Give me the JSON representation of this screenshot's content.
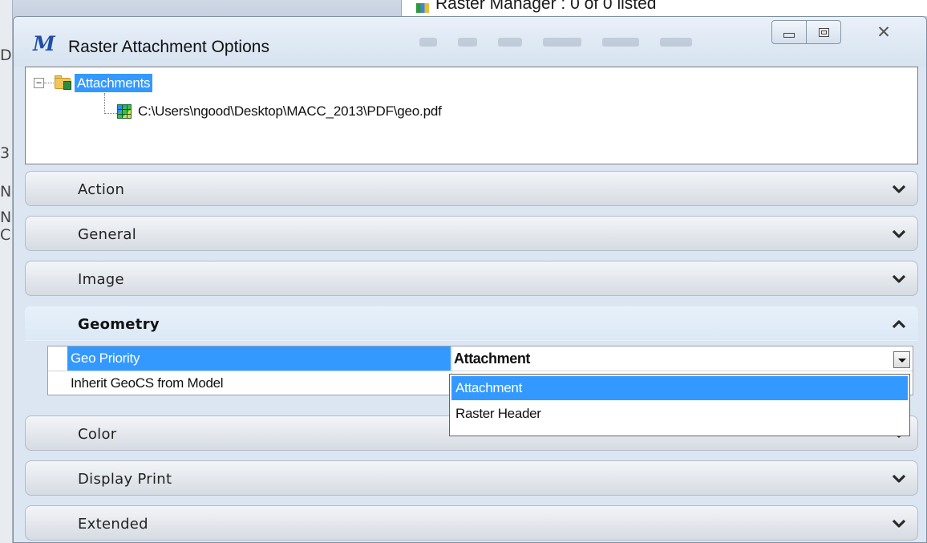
{
  "background": {
    "window_title": "Raster Manager : 0 of 0 listed",
    "left_edge_letters": [
      "D",
      "3",
      "N",
      "N",
      "C"
    ]
  },
  "dialog": {
    "title": "Raster Attachment Options",
    "tree": {
      "root_label": "Attachments",
      "root_expanded": true,
      "children": [
        {
          "label": "C:\\Users\\ngood\\Desktop\\MACC_2013\\PDF\\geo.pdf"
        }
      ]
    },
    "sections": [
      {
        "label": "Action",
        "expanded": false
      },
      {
        "label": "General",
        "expanded": false
      },
      {
        "label": "Image",
        "expanded": false
      },
      {
        "label": "Geometry",
        "expanded": true
      },
      {
        "label": "Color",
        "expanded": false
      },
      {
        "label": "Display Print",
        "expanded": false
      },
      {
        "label": "Extended",
        "expanded": false
      }
    ],
    "geometry_properties": [
      {
        "label": "Geo Priority",
        "value": "Attachment",
        "selected": true
      },
      {
        "label": "Inherit GeoCS from Model",
        "value": "",
        "selected": false
      }
    ],
    "dropdown": {
      "options": [
        "Attachment",
        "Raster Header"
      ],
      "highlighted": "Attachment"
    }
  },
  "colors": {
    "selection": "#3399ff",
    "dialog_bg": "#dbe6f2",
    "section_bg": "#e3e7ec"
  }
}
